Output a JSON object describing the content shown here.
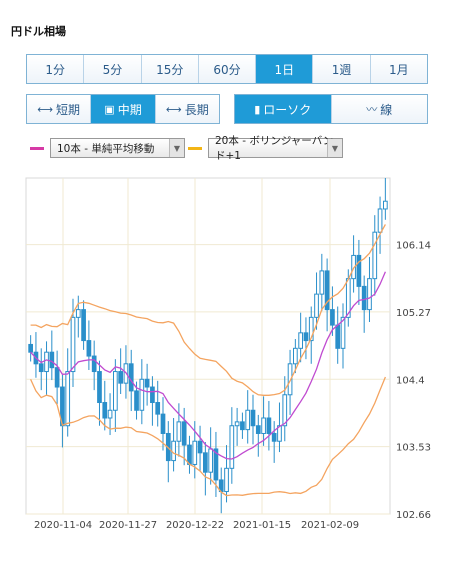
{
  "title": "円ドル相場",
  "period_tabs": [
    {
      "label": "1分",
      "active": false
    },
    {
      "label": "5分",
      "active": false
    },
    {
      "label": "15分",
      "active": false
    },
    {
      "label": "60分",
      "active": false
    },
    {
      "label": "1日",
      "active": true
    },
    {
      "label": "1週",
      "active": false
    },
    {
      "label": "1月",
      "active": false
    }
  ],
  "range_tabs": [
    {
      "label": "短期",
      "active": false
    },
    {
      "label": "中期",
      "active": true
    },
    {
      "label": "長期",
      "active": false
    }
  ],
  "chart_type_tabs": [
    {
      "label": "ローソク",
      "active": true
    },
    {
      "label": "線",
      "active": false
    }
  ],
  "indicators": [
    {
      "label": "10本 - 単純平均移動",
      "color": "#d63aa6"
    },
    {
      "label": "20本 - ボリンジャーバンド+1",
      "color": "#f3b515"
    }
  ],
  "chart_data": {
    "type": "candlestick",
    "title": "",
    "xlabel": "",
    "ylabel": "",
    "x_tick_labels": [
      "2020-11-04",
      "2020-11-27",
      "2020-12-22",
      "2021-01-15",
      "2021-02-09"
    ],
    "y_tick_labels": [
      "106.14",
      "105.27",
      "104.4",
      "103.53",
      "102.66"
    ],
    "ylim": [
      102.66,
      107.0
    ],
    "grid": true,
    "colors": {
      "candle": "#2a8fca",
      "ma10": "#c04bd0",
      "bollinger": "#f4a460",
      "grid": "#f0ead2"
    },
    "closes": [
      104.75,
      104.6,
      104.5,
      104.75,
      104.55,
      104.3,
      103.8,
      104.5,
      105.2,
      105.3,
      104.9,
      104.7,
      104.5,
      104.1,
      103.9,
      104.0,
      104.5,
      104.35,
      104.6,
      104.25,
      104.0,
      104.4,
      104.3,
      104.1,
      103.95,
      103.7,
      103.35,
      103.6,
      103.85,
      103.55,
      103.3,
      103.6,
      103.45,
      103.2,
      103.5,
      103.1,
      102.95,
      103.25,
      103.8,
      103.85,
      103.75,
      104.0,
      103.8,
      103.7,
      103.9,
      103.7,
      103.6,
      103.8,
      104.2,
      104.6,
      104.8,
      105.0,
      104.9,
      105.2,
      105.5,
      105.8,
      105.3,
      105.1,
      104.8,
      105.2,
      105.7,
      106.0,
      105.6,
      105.3,
      105.7,
      106.3,
      106.6,
      106.7
    ]
  }
}
